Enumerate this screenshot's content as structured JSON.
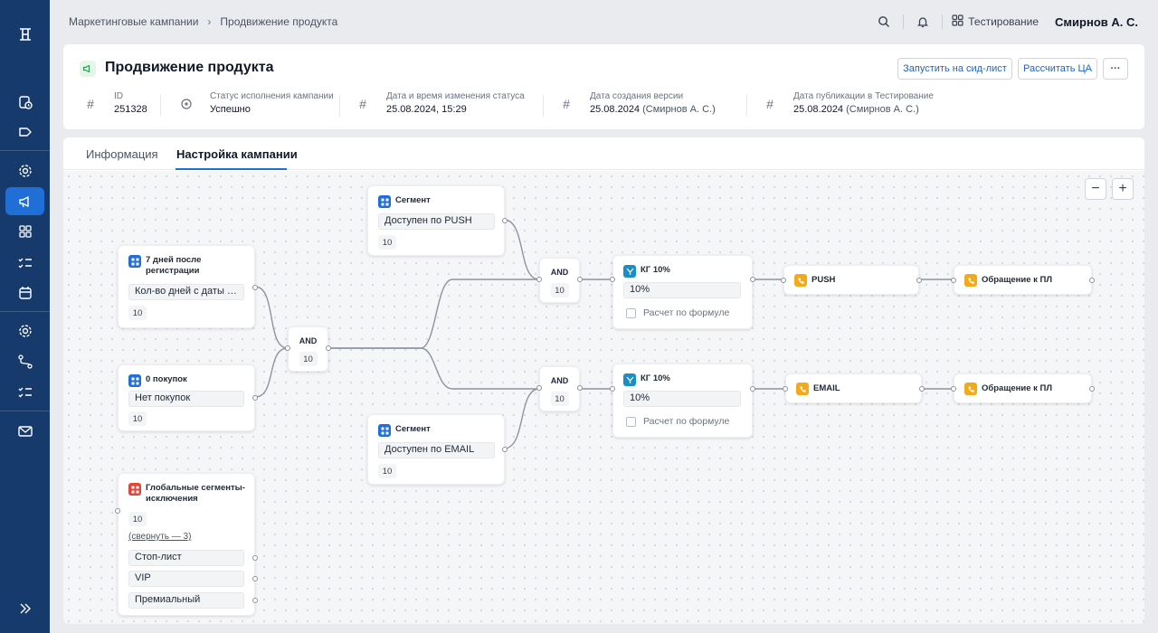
{
  "sidebar": {
    "logo_icon": "h-logo-icon",
    "items": [
      {
        "name": "dashboard",
        "icon": "clock-shield-icon"
      },
      {
        "name": "tags",
        "icon": "tag-icon"
      },
      {
        "name": "settings",
        "icon": "gear-icon"
      },
      {
        "name": "campaigns",
        "icon": "megaphone-icon",
        "active": true
      },
      {
        "name": "widgets",
        "icon": "grid-icon"
      },
      {
        "name": "tasks",
        "icon": "checklist-icon"
      },
      {
        "name": "calendar",
        "icon": "calendar-icon"
      },
      {
        "name": "config",
        "icon": "gear-icon"
      },
      {
        "name": "routes",
        "icon": "route-icon"
      },
      {
        "name": "lists",
        "icon": "checklist-icon"
      },
      {
        "name": "mail",
        "icon": "mail-icon"
      }
    ],
    "expand_icon": "double-chevron-right-icon",
    "accent": "#1f6fd6",
    "background": "#163a6b"
  },
  "topbar": {
    "breadcrumb": [
      "Маркетинговые кампании",
      "Продвижение продукта"
    ],
    "breadcrumb_sep": "›",
    "env_label": "Тестирование",
    "user_name": "Смирнов А. С."
  },
  "header": {
    "title": "Продвижение продукта",
    "btn_seed": "Запустить на сид-лист",
    "btn_calc": "Рассчитать ЦА",
    "btn_more": "···",
    "meta": [
      {
        "label": "ID",
        "value": "251328",
        "muted": ""
      },
      {
        "label": "Статус исполнения кампании",
        "value": "Успешно",
        "muted": ""
      },
      {
        "label": "Дата и время изменения статуса",
        "value": "25.08.2024, 15:29",
        "muted": ""
      },
      {
        "label": "Дата создания версии",
        "value": "25.08.2024",
        "muted": "(Смирнов А. С.)"
      },
      {
        "label": "Дата публикации в Тестирование",
        "value": "25.08.2024",
        "muted": "(Смирнов А. С.)"
      }
    ]
  },
  "tabs": [
    {
      "label": "Информация",
      "active": false
    },
    {
      "label": "Настройка кампании",
      "active": true
    }
  ],
  "zoom": {
    "minus": "−",
    "plus": "+"
  },
  "nodes": {
    "seg_push": {
      "title": "Сегмент",
      "field": "Доступен по PUSH",
      "badge": "10"
    },
    "days": {
      "title": "7 дней после регистрации",
      "field": "Кол-во дней с даты р...",
      "badge": "10"
    },
    "purchases": {
      "title": "0 покупок",
      "field": "Нет покупок",
      "badge": "10"
    },
    "and_main": {
      "label": "AND",
      "badge": "10"
    },
    "seg_email": {
      "title": "Сегмент",
      "field": "Доступен по EMAIL",
      "badge": "10"
    },
    "global_excl": {
      "title": "Глобальные сегменты-исключения",
      "badge": "10",
      "link": "(свернуть — 3)",
      "items": [
        "Стоп-лист",
        "VIP",
        "Премиальный"
      ]
    },
    "and_push": {
      "label": "AND",
      "badge": "10"
    },
    "and_email": {
      "label": "AND",
      "badge": "10"
    },
    "kg_push": {
      "title": "КГ 10%",
      "field": "10%",
      "check": "Расчет по формуле"
    },
    "kg_email": {
      "title": "КГ 10%",
      "field": "10%",
      "check": "Расчет по формуле"
    },
    "ch_push": {
      "title": "PUSH"
    },
    "ch_email": {
      "title": "EMAIL"
    },
    "appeal_push": {
      "title": "Обращение к ПЛ"
    },
    "appeal_email": {
      "title": "Обращение к ПЛ"
    }
  }
}
